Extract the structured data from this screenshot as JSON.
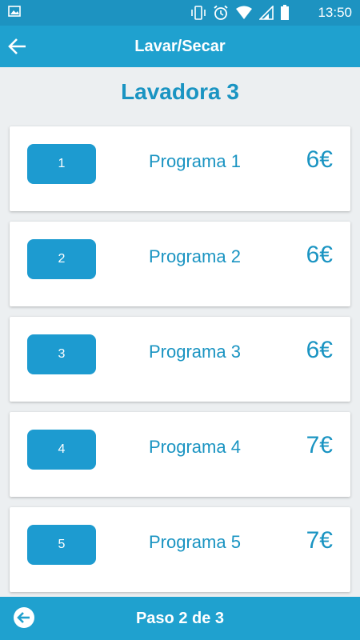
{
  "status_bar": {
    "time": "13:50",
    "icons": [
      "image-icon",
      "vibrate-icon",
      "alarm-icon",
      "wifi-icon",
      "signal-icon",
      "battery-icon"
    ]
  },
  "app_bar": {
    "title": "Lavar/Secar",
    "back_icon": "arrow-left-icon"
  },
  "page": {
    "heading": "Lavadora 3"
  },
  "programs": [
    {
      "number": "1",
      "name": "Programa 1",
      "price": "6€"
    },
    {
      "number": "2",
      "name": "Programa 2",
      "price": "6€"
    },
    {
      "number": "3",
      "name": "Programa 3",
      "price": "6€"
    },
    {
      "number": "4",
      "name": "Programa 4",
      "price": "7€"
    },
    {
      "number": "5",
      "name": "Programa 5",
      "price": "7€"
    }
  ],
  "bottom_bar": {
    "step_text": "Paso 2 de 3",
    "back_icon": "circle-arrow-left-icon"
  },
  "colors": {
    "primary": "#1fa1cf",
    "status": "#1d93c1",
    "accent_text": "#1a94c2",
    "button": "#1d9bd0",
    "background": "#eceff1"
  }
}
